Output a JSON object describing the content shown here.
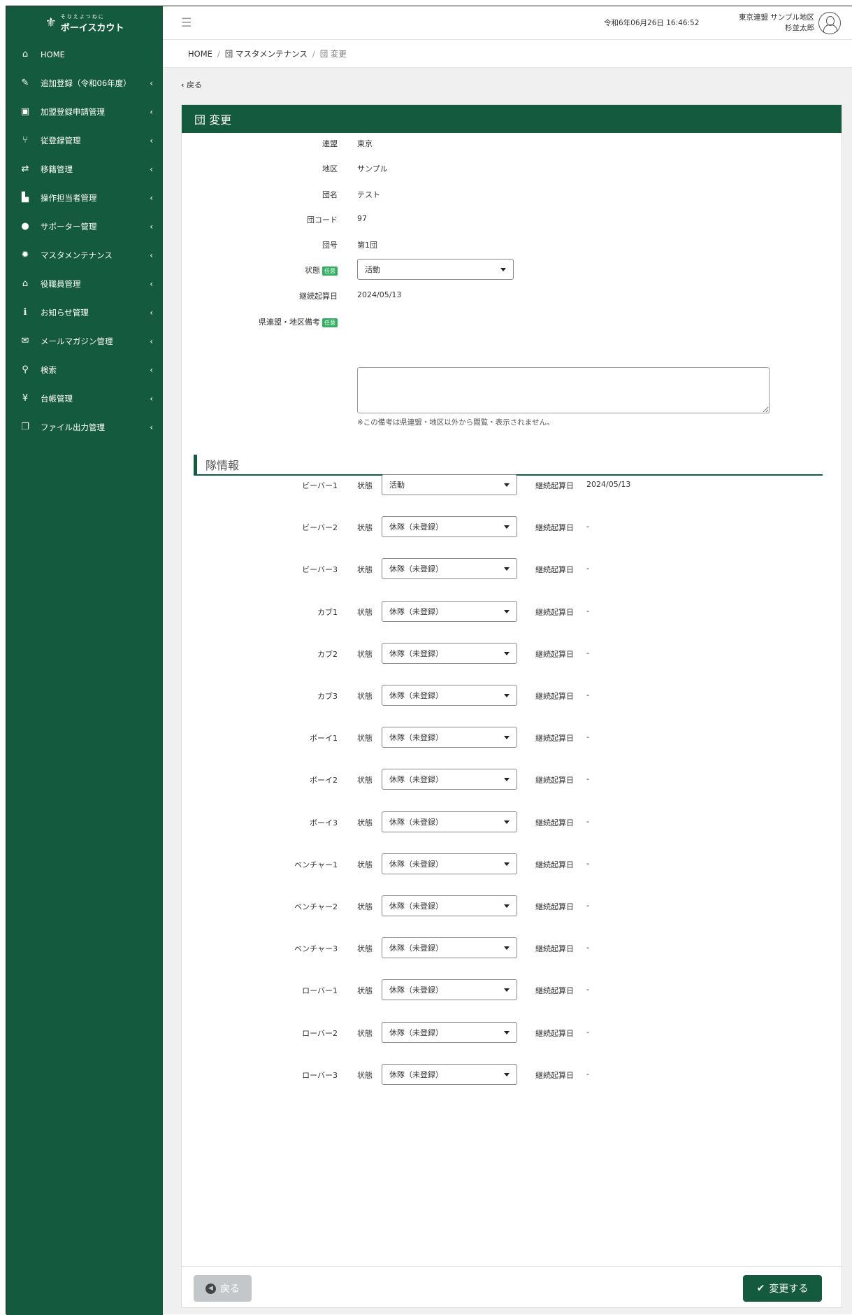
{
  "app": {
    "logo_sub": "そなえよつねに",
    "logo_main": "ボーイスカウト"
  },
  "sidebar": {
    "items": [
      {
        "icon": "home-icon",
        "glyph": "⌂",
        "label": "HOME"
      },
      {
        "icon": "edit-icon",
        "glyph": "✎",
        "label": "追加登録（令和06年度）"
      },
      {
        "icon": "id-card-icon",
        "glyph": "▣",
        "label": "加盟登録申請管理"
      },
      {
        "icon": "branch-icon",
        "glyph": "⑂",
        "label": "従登録管理"
      },
      {
        "icon": "transfer-icon",
        "glyph": "⇄",
        "label": "移籍管理"
      },
      {
        "icon": "presenter-icon",
        "glyph": "▙",
        "label": "操作担当者管理"
      },
      {
        "icon": "user-icon",
        "glyph": "●",
        "label": "サポーター管理"
      },
      {
        "icon": "gear-icon",
        "glyph": "✹",
        "label": "マスタメンテナンス"
      },
      {
        "icon": "building-icon",
        "glyph": "⌂",
        "label": "役職員管理"
      },
      {
        "icon": "info-icon",
        "glyph": "ℹ",
        "label": "お知らせ管理"
      },
      {
        "icon": "envelope-icon",
        "glyph": "✉",
        "label": "メールマガジン管理"
      },
      {
        "icon": "search-icon",
        "glyph": "⚲",
        "label": "検索"
      },
      {
        "icon": "yen-icon",
        "glyph": "¥",
        "label": "台帳管理"
      },
      {
        "icon": "files-icon",
        "glyph": "❐",
        "label": "ファイル出力管理"
      }
    ]
  },
  "topbar": {
    "datetime": "令和6年06月26日 16:46:52",
    "user_line1": "東京連盟 サンプル地区",
    "user_line2": "杉並太郎"
  },
  "breadcrumb": {
    "home": "HOME",
    "parent": "団 マスタメンテナンス",
    "current": "団 変更"
  },
  "back_link": "戻る",
  "card_title": "団 変更",
  "form": {
    "renmei_label": "連盟",
    "renmei_value": "東京",
    "chiku_label": "地区",
    "chiku_value": "サンプル",
    "danmei_label": "団名",
    "danmei_value": "テスト",
    "dancode_label": "団コード",
    "dancode_value": "97",
    "dango_label": "団号",
    "dango_value": "第1団",
    "status_label": "状態",
    "status_badge": "任意",
    "status_value": "活動",
    "keizoku_label": "継続起算日",
    "keizoku_value": "2024/05/13",
    "memo_label": "県連盟・地区備考",
    "memo_badge": "任意",
    "memo_value": "",
    "memo_note": "※この備考は県連盟・地区以外から閲覧・表示されません。"
  },
  "units_section": {
    "title": "隊情報",
    "status_label": "状態",
    "date_label": "継続起算日",
    "units": [
      {
        "name": "ビーバー1",
        "status": "活動",
        "date": "2024/05/13"
      },
      {
        "name": "ビーバー2",
        "status": "休隊（未登録）",
        "date": "-"
      },
      {
        "name": "ビーバー3",
        "status": "休隊（未登録）",
        "date": "-"
      },
      {
        "name": "カブ1",
        "status": "休隊（未登録）",
        "date": "-"
      },
      {
        "name": "カブ2",
        "status": "休隊（未登録）",
        "date": "-"
      },
      {
        "name": "カブ3",
        "status": "休隊（未登録）",
        "date": "-"
      },
      {
        "name": "ボーイ1",
        "status": "休隊（未登録）",
        "date": "-"
      },
      {
        "name": "ボーイ2",
        "status": "休隊（未登録）",
        "date": "-"
      },
      {
        "name": "ボーイ3",
        "status": "休隊（未登録）",
        "date": "-"
      },
      {
        "name": "ベンチャー1",
        "status": "休隊（未登録）",
        "date": "-"
      },
      {
        "name": "ベンチャー2",
        "status": "休隊（未登録）",
        "date": "-"
      },
      {
        "name": "ベンチャー3",
        "status": "休隊（未登録）",
        "date": "-"
      },
      {
        "name": "ローバー1",
        "status": "休隊（未登録）",
        "date": "-"
      },
      {
        "name": "ローバー2",
        "status": "休隊（未登録）",
        "date": "-"
      },
      {
        "name": "ローバー3",
        "status": "休隊（未登録）",
        "date": "-"
      }
    ]
  },
  "footer": {
    "back_button": "戻る",
    "submit_button": "変更する"
  },
  "colors": {
    "brand_green": "#145a3e",
    "badge_green": "#34b062",
    "back_button_gray": "#c4c7ca"
  }
}
